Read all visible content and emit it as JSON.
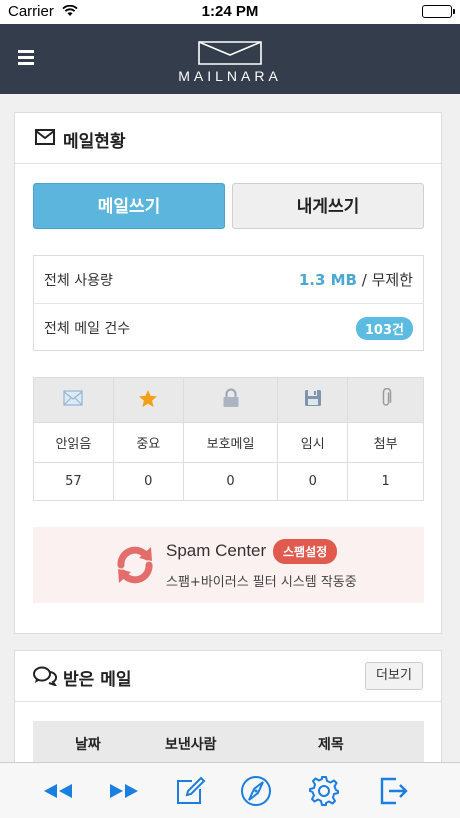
{
  "status_bar": {
    "carrier": "Carrier",
    "time": "1:24 PM"
  },
  "header": {
    "logo_text": "MAILNARA",
    "menu_icon": "hamburger-menu-icon",
    "logo_icon": "envelope-logo-icon"
  },
  "mail_status": {
    "title": "메일현황",
    "title_icon": "envelope-icon",
    "write_button": "메일쓰기",
    "write_self_button": "내게쓰기",
    "usage_label": "전체 사용량",
    "usage_value": "1.3 MB",
    "usage_separator": "/",
    "usage_limit": "무제한",
    "count_label": "전체 메일 건수",
    "count_value": "103건",
    "categories": [
      {
        "icon": "envelope-icon",
        "label": "안읽음",
        "count": "57"
      },
      {
        "icon": "star-icon",
        "label": "중요",
        "count": "0"
      },
      {
        "icon": "lock-icon",
        "label": "보호메일",
        "count": "0"
      },
      {
        "icon": "floppy-disk-icon",
        "label": "임시",
        "count": "0"
      },
      {
        "icon": "paperclip-icon",
        "label": "첨부",
        "count": "1"
      }
    ],
    "spam": {
      "icon": "refresh-swirl-icon",
      "title": "Spam Center",
      "button": "스팸설정",
      "subtitle": "스팸+바이러스 필터 시스템 작동중"
    }
  },
  "inbox": {
    "title": "받은 메일",
    "title_icon": "chat-bubbles-icon",
    "more_button": "더보기",
    "columns": [
      "날짜",
      "보낸사람",
      "제목"
    ]
  },
  "toolbar": {
    "items": [
      "rewind-icon",
      "fast-forward-icon",
      "compose-icon",
      "compass-icon",
      "gear-icon",
      "logout-icon"
    ]
  },
  "colors": {
    "nav": "#333d4b",
    "accent": "#5bb5dc",
    "icon_blue": "#1a7fe0",
    "spam_red": "#e05a4e"
  }
}
